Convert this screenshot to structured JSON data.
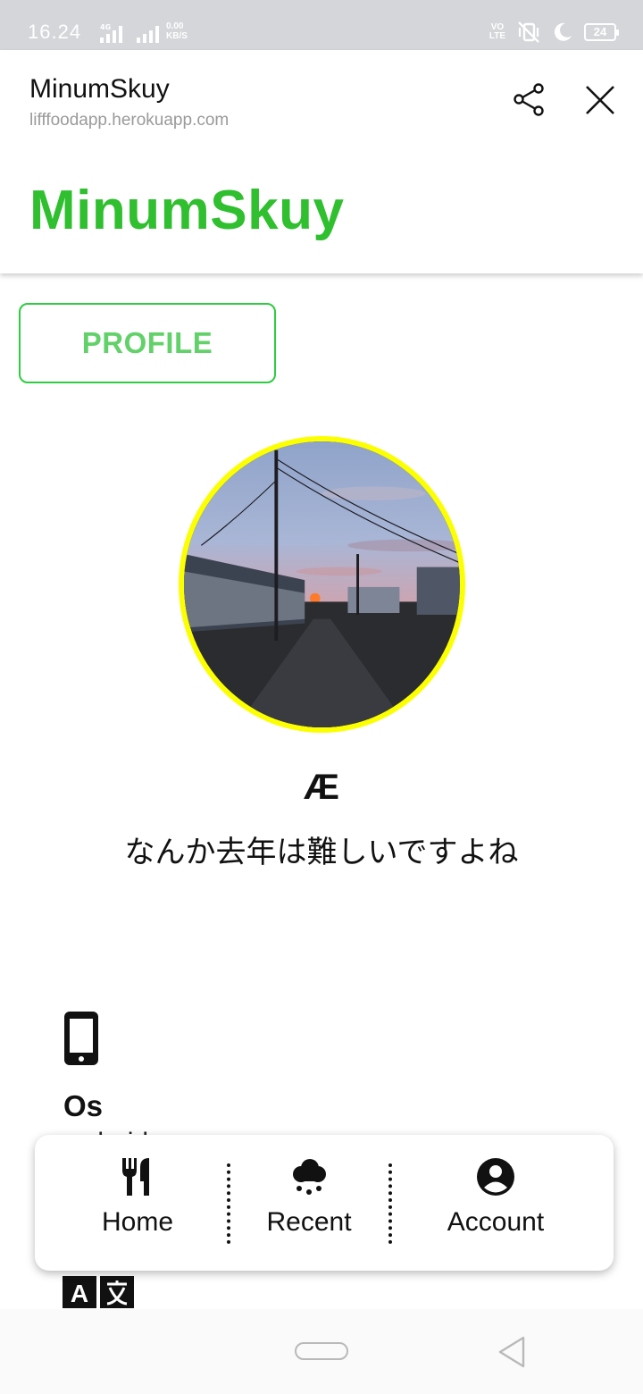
{
  "status_bar": {
    "time": "16.24",
    "net_type": "4G",
    "speed_value": "0.00",
    "speed_unit": "KB/S",
    "volte_top": "VO",
    "volte_bottom": "LTE",
    "battery": "24"
  },
  "header": {
    "app_title": "MinumSkuy",
    "url": "lifffoodapp.herokuapp.com",
    "brand_title": "MinumSkuy",
    "share_icon": "share-icon",
    "close_icon": "close-icon"
  },
  "profile_button": {
    "label": "PROFILE"
  },
  "profile": {
    "avatar": "sunset-photo",
    "display_name": "Æ",
    "status_message": "なんか去年は難しいですよね"
  },
  "info": {
    "os_label": "Os",
    "os_value": "android",
    "phone_icon": "phone-icon",
    "language_icon": "translate-icon"
  },
  "bottom_nav": {
    "items": [
      {
        "label": "Home",
        "icon": "utensils-icon"
      },
      {
        "label": "Recent",
        "icon": "cloud-icon"
      },
      {
        "label": "Account",
        "icon": "user-circle-icon"
      }
    ]
  },
  "colors": {
    "brand": "#2fbf2f",
    "profile_button_text": "#63d16a",
    "profile_button_border": "#2ecc40",
    "avatar_ring": "#fbff00",
    "status_bar": "#d4d6da"
  }
}
